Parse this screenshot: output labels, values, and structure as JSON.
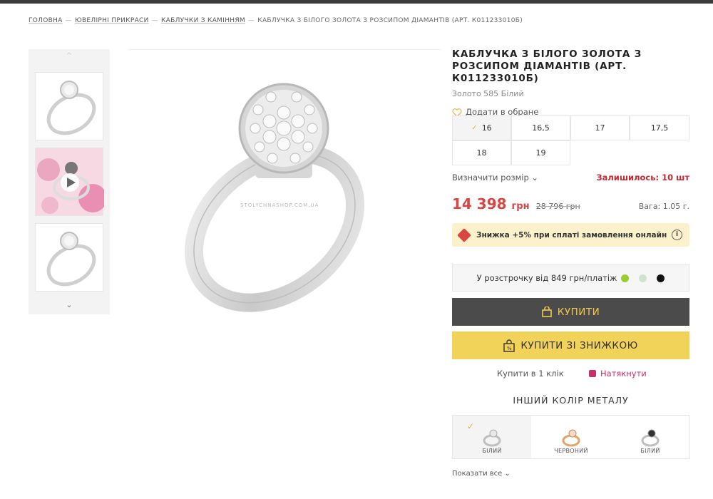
{
  "breadcrumb": {
    "items": [
      "Головна",
      "Ювелірні прикраси",
      "Каблучки з камінням"
    ],
    "current": "Каблучка з білого золота з розсипом діамантів (Арт. К011233010б)"
  },
  "gallery": {
    "watermark": "STOLYCHNASHOP.COM.UA"
  },
  "product": {
    "title": "КАБЛУЧКА З БІЛОГО ЗОЛОТА З РОЗСИПОМ ДІАМАНТІВ (АРТ. К011233010Б)",
    "subtitle": "Золото 585 Білий",
    "favorite_label": "Додати в обране"
  },
  "sizes": {
    "options": [
      "16",
      "16,5",
      "17",
      "17,5",
      "18",
      "19"
    ],
    "selected": "16",
    "define_label": "Визначити розмір",
    "remaining": "Залишилось: 10 шт"
  },
  "price": {
    "current": "14 398",
    "currency": "грн",
    "old": "28 796 грн",
    "weight": "Вага: 1.05 г."
  },
  "promo": {
    "text": "Знижка +5% при сплаті замовлення онлайн"
  },
  "credit": {
    "text": "У розстрочку від 849 грн/платіж"
  },
  "buttons": {
    "buy": "КУПИТИ",
    "buy_discount": "КУПИТИ ЗІ ЗНИЖКОЮ",
    "one_click": "Купити в 1 клік",
    "hint": "Натякнути"
  },
  "metal": {
    "title": "ІНШИЙ КОЛІР МЕТАЛУ",
    "options": [
      "БІЛИЙ",
      "ЧЕРВОНИЙ",
      "БІЛИЙ"
    ],
    "show_all": "Показати все"
  },
  "colors": {
    "accent": "#f2d35a",
    "dark": "#4b4b4b",
    "price": "#d94541",
    "stock": "#c9262e",
    "hint": "#c4306a"
  }
}
